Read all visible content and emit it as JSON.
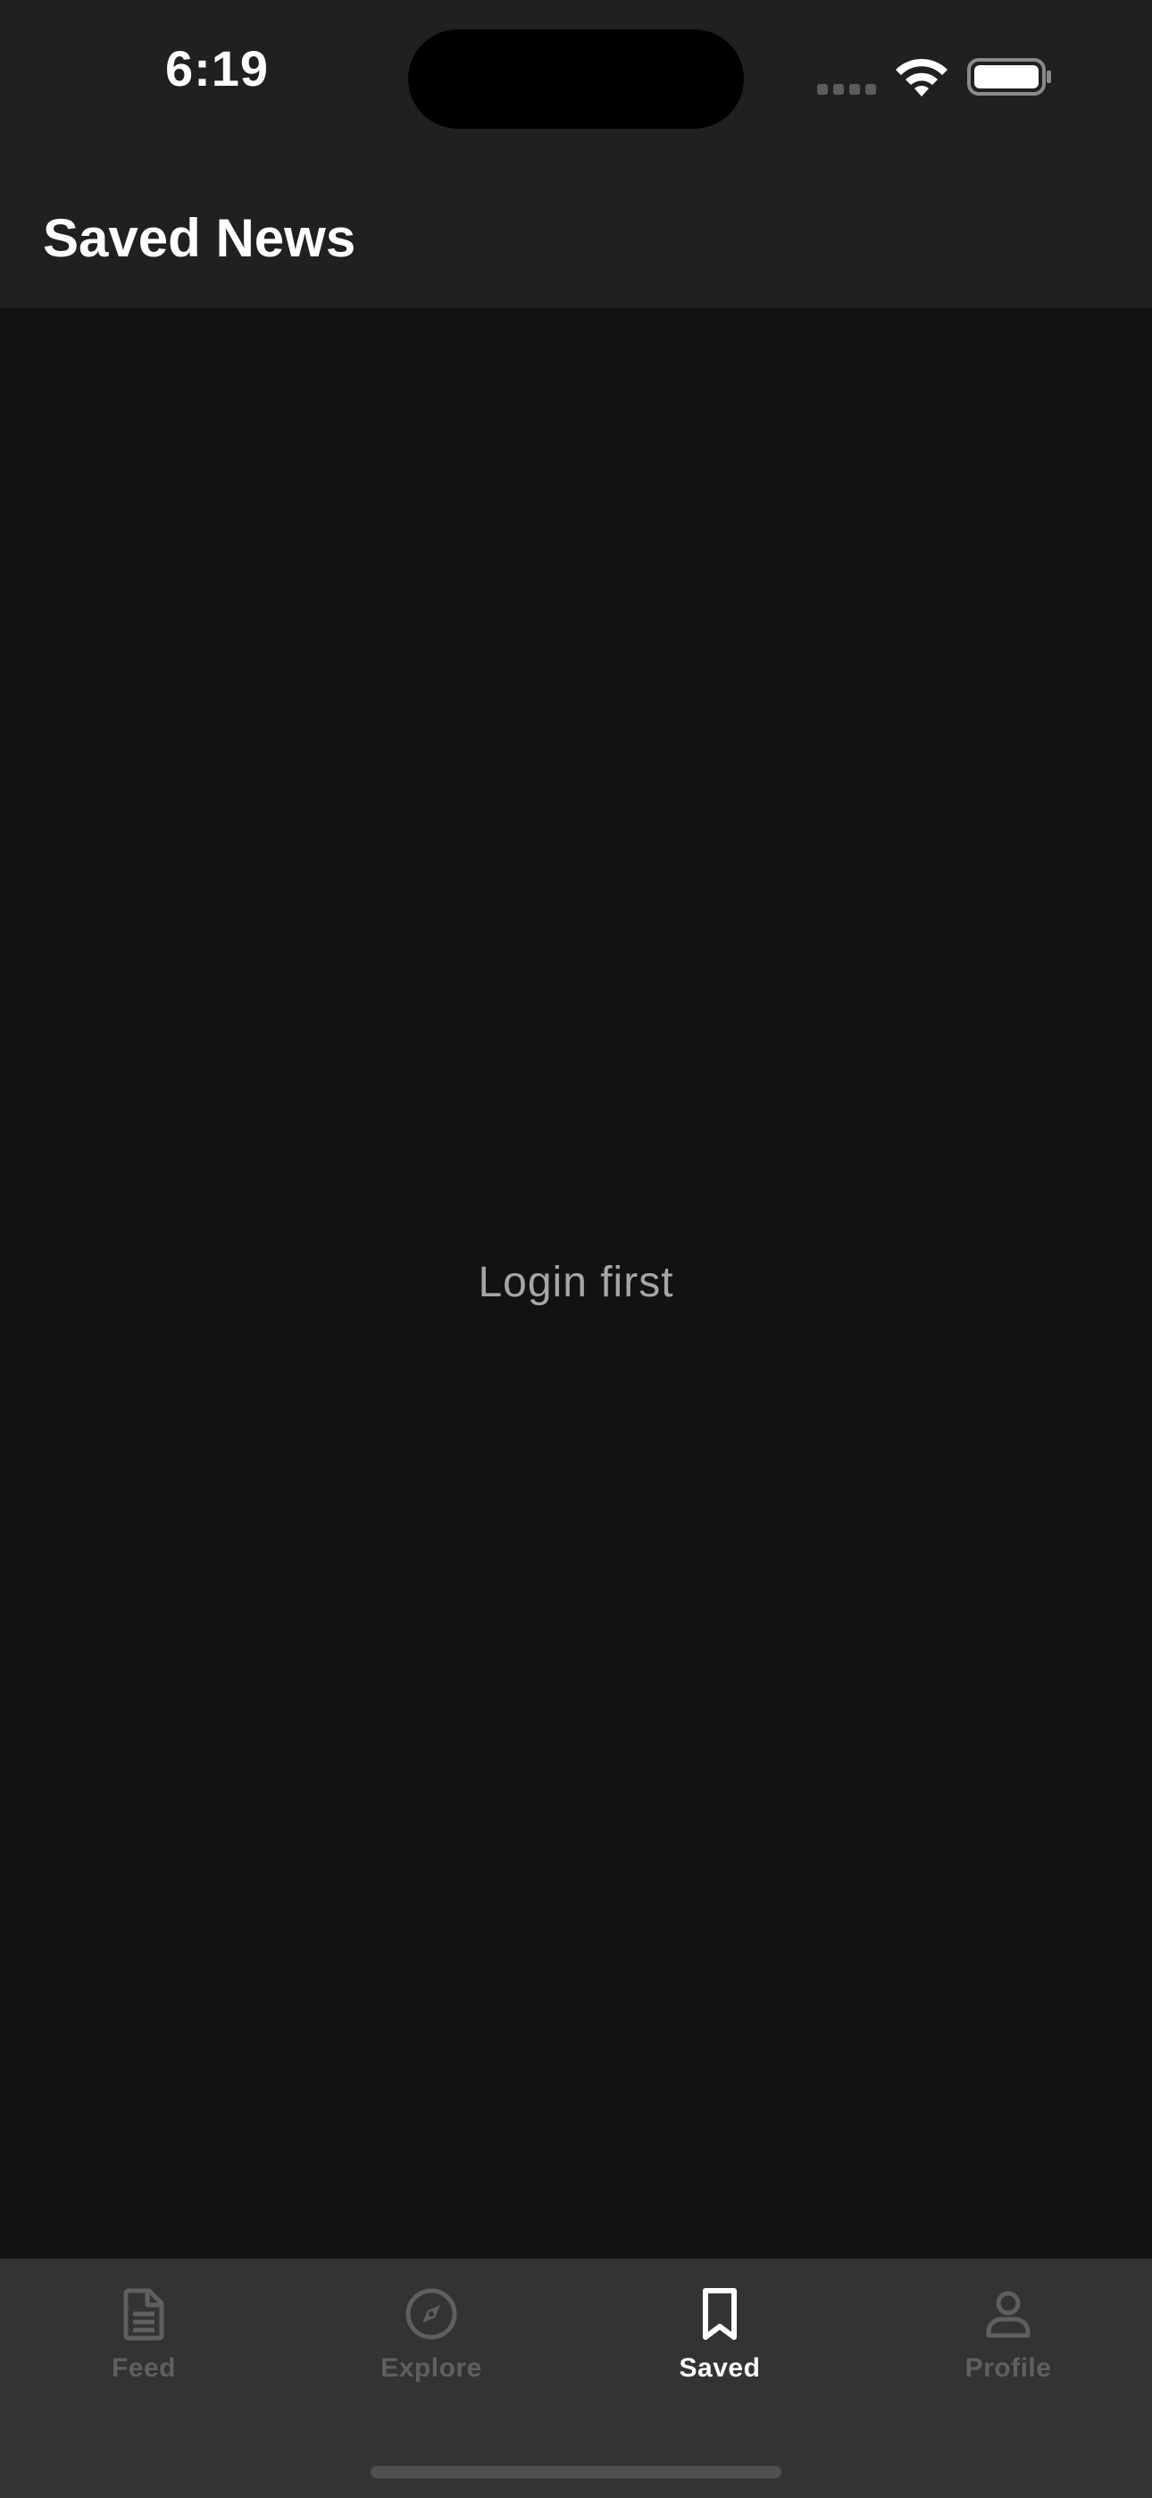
{
  "status_bar": {
    "time": "6:19"
  },
  "header": {
    "title": "Saved News"
  },
  "main": {
    "empty_message": "Login first"
  },
  "tab_bar": {
    "tabs": [
      {
        "label": "Feed",
        "icon": "document-icon",
        "active": false
      },
      {
        "label": "Explore",
        "icon": "compass-icon",
        "active": false
      },
      {
        "label": "Saved",
        "icon": "bookmark-icon",
        "active": true
      },
      {
        "label": "Profile",
        "icon": "person-icon",
        "active": false
      }
    ]
  },
  "colors": {
    "background": "#121212",
    "header": "#202020",
    "tab_bar": "#333333",
    "active": "#ffffff",
    "inactive": "#5f5f5f"
  }
}
